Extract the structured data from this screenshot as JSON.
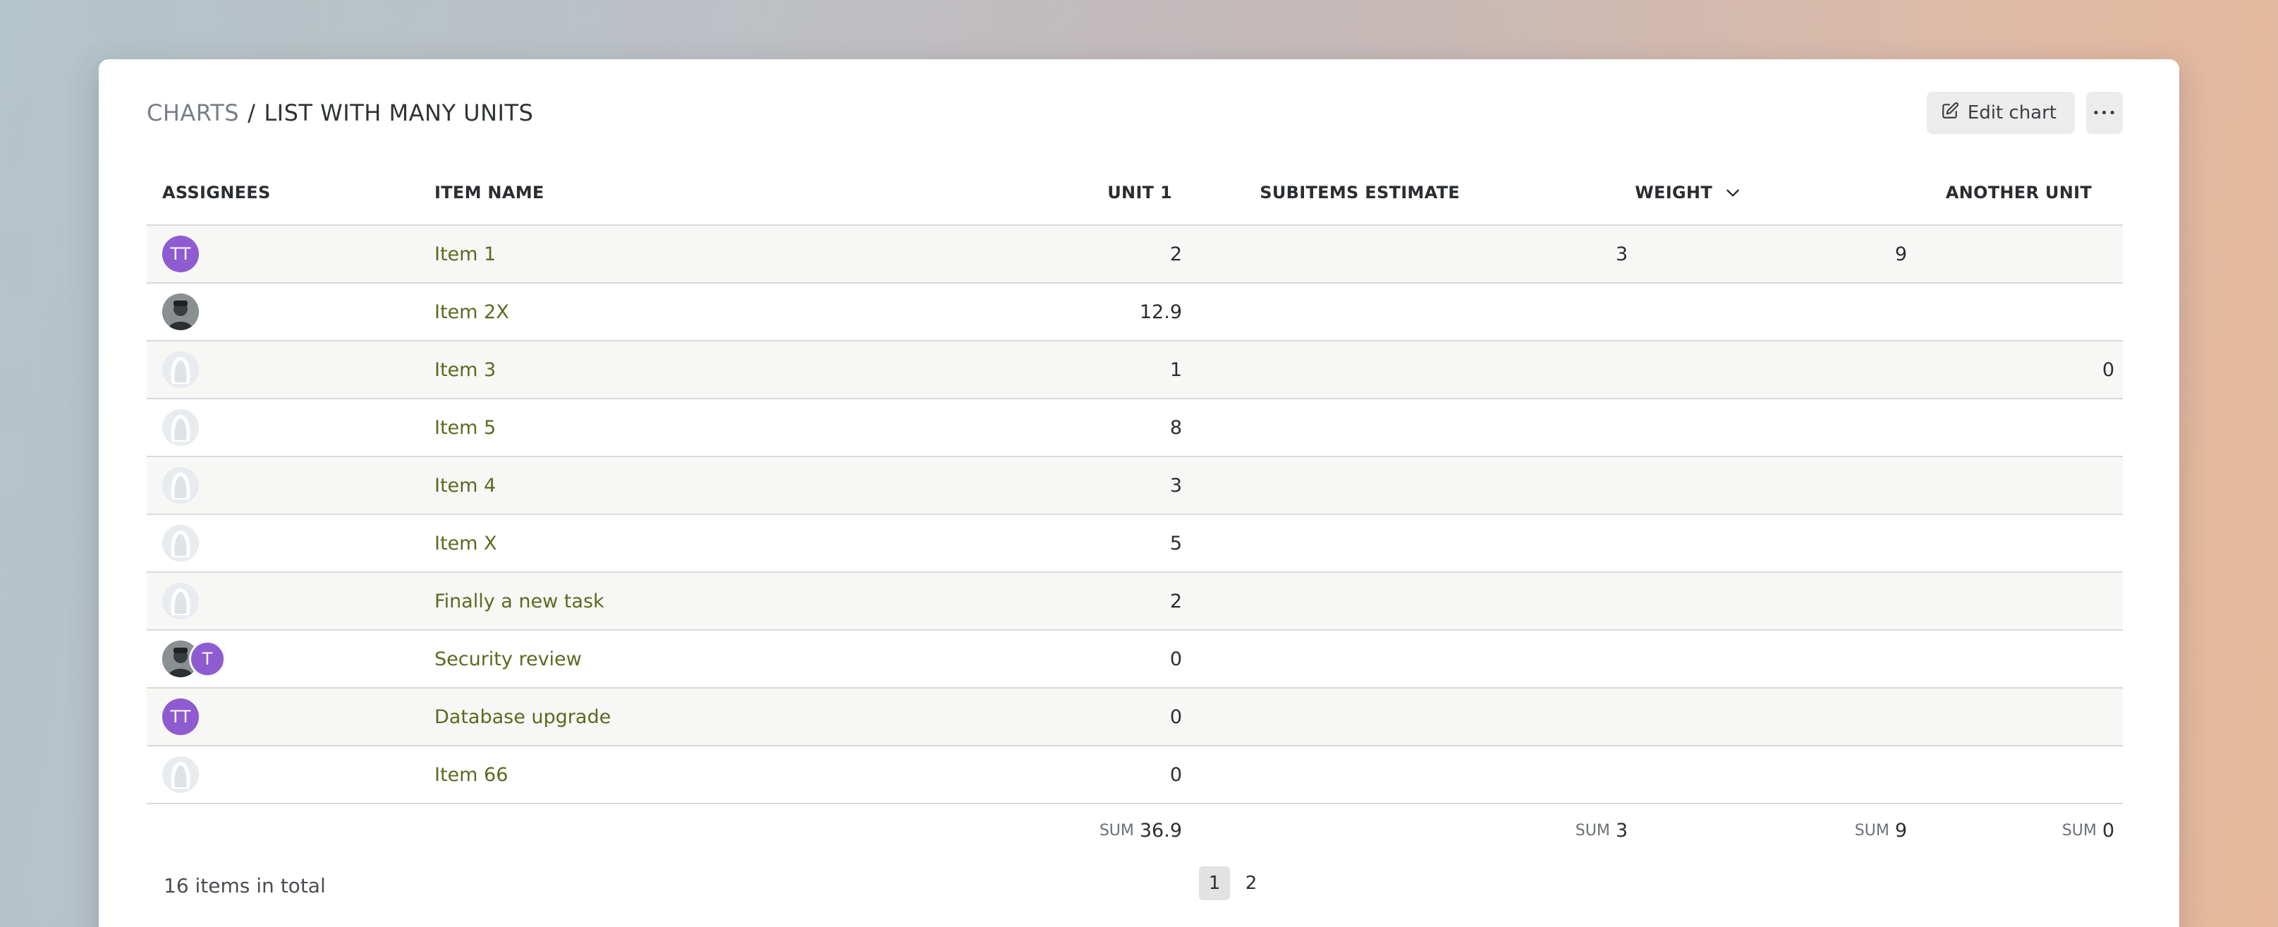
{
  "breadcrumb": {
    "root": "CHARTS",
    "separator": "/",
    "current": "LIST WITH MANY UNITS"
  },
  "actions": {
    "edit_label": "Edit chart",
    "more_label": "•••"
  },
  "columns": {
    "assignees": "ASSIGNEES",
    "item_name": "ITEM NAME",
    "unit1": "UNIT 1",
    "subitems": "SUBITEMS ESTIMATE",
    "weight": "WEIGHT",
    "another": "ANOTHER UNIT"
  },
  "rows": [
    {
      "assignees": [
        {
          "type": "initials",
          "text": "TT"
        }
      ],
      "name": "Item 1",
      "unit1": "2",
      "subitems": "3",
      "weight": "9",
      "another": ""
    },
    {
      "assignees": [
        {
          "type": "photo"
        }
      ],
      "name": "Item 2X",
      "unit1": "12.9",
      "subitems": "",
      "weight": "",
      "another": ""
    },
    {
      "assignees": [
        {
          "type": "placeholder"
        }
      ],
      "name": "Item 3",
      "unit1": "1",
      "subitems": "",
      "weight": "",
      "another": "0"
    },
    {
      "assignees": [
        {
          "type": "placeholder"
        }
      ],
      "name": "Item 5",
      "unit1": "8",
      "subitems": "",
      "weight": "",
      "another": ""
    },
    {
      "assignees": [
        {
          "type": "placeholder"
        }
      ],
      "name": "Item 4",
      "unit1": "3",
      "subitems": "",
      "weight": "",
      "another": ""
    },
    {
      "assignees": [
        {
          "type": "placeholder"
        }
      ],
      "name": "Item X",
      "unit1": "5",
      "subitems": "",
      "weight": "",
      "another": ""
    },
    {
      "assignees": [
        {
          "type": "placeholder"
        }
      ],
      "name": "Finally a new task",
      "unit1": "2",
      "subitems": "",
      "weight": "",
      "another": ""
    },
    {
      "assignees": [
        {
          "type": "photo"
        },
        {
          "type": "initials",
          "text": "T"
        }
      ],
      "name": "Security review",
      "unit1": "0",
      "subitems": "",
      "weight": "",
      "another": ""
    },
    {
      "assignees": [
        {
          "type": "initials",
          "text": "TT"
        }
      ],
      "name": "Database upgrade",
      "unit1": "0",
      "subitems": "",
      "weight": "",
      "another": ""
    },
    {
      "assignees": [
        {
          "type": "placeholder"
        }
      ],
      "name": "Item 66",
      "unit1": "0",
      "subitems": "",
      "weight": "",
      "another": ""
    }
  ],
  "sums": {
    "label": "SUM",
    "unit1": "36.9",
    "subitems": "3",
    "weight": "9",
    "another": "0"
  },
  "footer": {
    "total": "16 items in total",
    "pages": [
      "1",
      "2"
    ],
    "current_page": "1"
  },
  "colors": {
    "link": "#5a6b1f",
    "avatar_initials": "#8e5bd1"
  },
  "icons": {
    "edit": "edit-icon",
    "more": "more-horizontal-icon",
    "sort": "chevron-down-icon"
  }
}
